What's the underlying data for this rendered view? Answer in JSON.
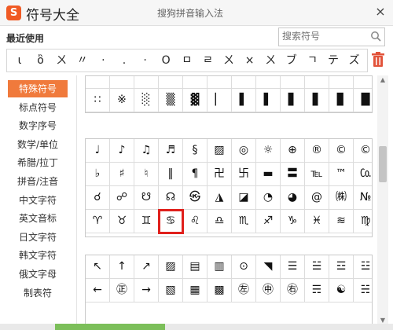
{
  "window": {
    "app_title": "符号大全",
    "subtitle": "搜狗拼音输入法",
    "close_glyph": "×",
    "logo_glyph": "S"
  },
  "recent": {
    "label": "最近使用",
    "items": [
      "ι",
      "ὂ",
      "ㄨ",
      "〃",
      "·",
      ".",
      "·",
      "O",
      "ㅁ",
      "ㄹ",
      "ㄨ",
      "×",
      "ㄨ",
      "ブ",
      "ㄱ",
      "テ",
      "ズ"
    ]
  },
  "search": {
    "placeholder": "搜索符号"
  },
  "sidebar": {
    "items": [
      "特殊符号",
      "标点符号",
      "数字序号",
      "数学/单位",
      "希腊/拉丁",
      "拼音/注音",
      "中文字符",
      "英文音标",
      "日文字符",
      "韩文字符",
      "俄文字母",
      "制表符"
    ],
    "active_index": 0
  },
  "panel1": {
    "rows": [
      [
        "",
        "",
        "",
        "▀",
        "▀",
        "▀",
        "▀",
        "▀",
        "▀",
        "▀",
        "▀",
        "▀"
      ],
      [
        "∷",
        "※",
        "░",
        "▒",
        "▓",
        "▏",
        "▌",
        "▌",
        "▋",
        "▋",
        "▊",
        "█"
      ]
    ]
  },
  "panel2": {
    "rows": [
      [
        "♩",
        "♪",
        "♫",
        "♬",
        "§",
        "▨",
        "◎",
        "☼",
        "⊕",
        "®",
        "©",
        "©"
      ],
      [
        "♭",
        "♯",
        "♮",
        "‖",
        "¶",
        "卍",
        "卐",
        "▬",
        "〓",
        "℡",
        "™",
        "㏇"
      ],
      [
        "☌",
        "☍",
        "☋",
        "☊",
        "㉿",
        "◮",
        "◪",
        "◔",
        "◕",
        "@",
        "㈱",
        "№"
      ],
      [
        "♈",
        "♉",
        "♊",
        "♋",
        "♌",
        "♎",
        "♏",
        "♐",
        "♑",
        "♓",
        "≋",
        "♍"
      ]
    ],
    "selected": {
      "row": 3,
      "col": 3
    }
  },
  "panel3": {
    "rows": [
      [
        "↖",
        "↑",
        "↗",
        "▨",
        "▤",
        "▥",
        "⊙",
        "◥",
        "☰",
        "☱",
        "☲",
        "☳"
      ],
      [
        "←",
        "㊣",
        "→",
        "▧",
        "▦",
        "▩",
        "㊧",
        "㊥",
        "㊨",
        "☴",
        "☯",
        "☵"
      ]
    ]
  },
  "colors": {
    "accent": "#f07a3c",
    "selection": "#e0201c",
    "logo": "#f05a24"
  }
}
